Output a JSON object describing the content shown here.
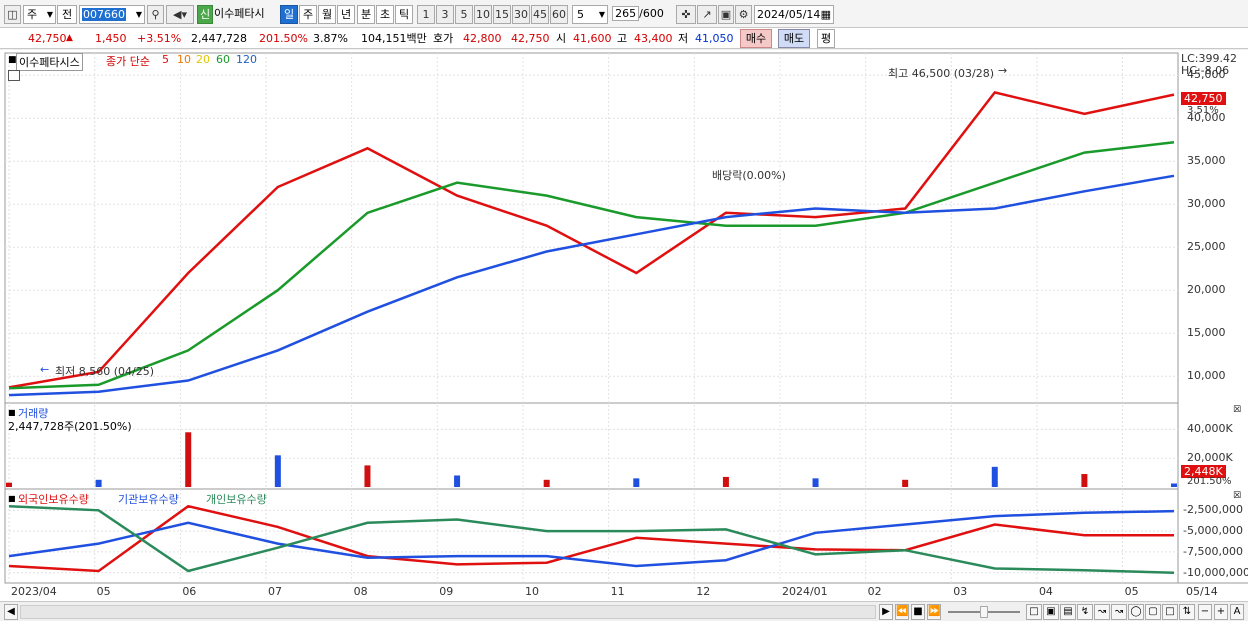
{
  "toolbar": {
    "market_select": "주",
    "compare_select": "전",
    "code": "007660",
    "stock_flag": "신",
    "stock_name": "이수페타시",
    "periods": [
      "일",
      "주",
      "월",
      "년",
      "분",
      "초",
      "틱"
    ],
    "active_period": "일",
    "intervals": [
      "1",
      "3",
      "5",
      "10",
      "15",
      "30",
      "45",
      "60"
    ],
    "interval_value": "5",
    "count": "265",
    "count_total": "/600",
    "date": "2024/05/14"
  },
  "info": {
    "price": "42,750",
    "change": "1,450",
    "change_pct": "+3.51%",
    "volume": "2,447,728",
    "vol_ratio": "201.50%",
    "turnover": "3.87%",
    "amount": "104,151백만",
    "ask_label": "호가",
    "ask": "42,800",
    "bid": "42,750",
    "open_label": "시",
    "open": "41,600",
    "high_label": "고",
    "high": "43,400",
    "low_label": "저",
    "low": "41,050",
    "buy_button": "매수",
    "sell_button": "매도",
    "eval_button": "평"
  },
  "price_panel": {
    "stock_label": "이수페타시스",
    "ma_label": "종가 단순",
    "ma_periods": [
      "5",
      "10",
      "20",
      "60",
      "120"
    ],
    "ma_colors": [
      "#e01010",
      "#f07800",
      "#f0e000",
      "#1a9a2a",
      "#2050e0"
    ],
    "lc": "LC:399.42",
    "hc": "HC:-8.06",
    "current_price": "42,750",
    "current_pct": "3.51%",
    "max_annotation": "최고 46,500 (03/28)",
    "min_annotation": "최저 8,560 (04/25)",
    "dividend_annotation": "배당락(0.00%)",
    "y_ticks": [
      "45,000",
      "40,000",
      "35,000",
      "30,000",
      "25,000",
      "20,000",
      "15,000",
      "10,000"
    ]
  },
  "volume_panel": {
    "title": "거래량",
    "value": "2,447,728주(201.50%)",
    "y_ticks": [
      "40,000K",
      "20,000K"
    ],
    "current": "2,448K",
    "current_pct": "201.50%"
  },
  "holding_panel": {
    "series": [
      "외국인보유수량",
      "기관보유수량",
      "개인보유수량"
    ],
    "colors": [
      "#e01010",
      "#2050e0",
      "#2a8a5a"
    ],
    "y_ticks": [
      "-2,500,000",
      "-5,000,000",
      "-7,500,000",
      "-10,000,000"
    ]
  },
  "x_axis": {
    "labels": [
      "2023/04",
      "05",
      "06",
      "07",
      "08",
      "09",
      "10",
      "11",
      "12",
      "2024/01",
      "02",
      "03",
      "04",
      "05"
    ],
    "end_label": "05/14"
  },
  "chart_data": [
    {
      "type": "line",
      "title": "이수페타시스",
      "x": [
        "2023/04",
        "2023/05",
        "2023/06",
        "2023/07",
        "2023/08",
        "2023/09",
        "2023/10",
        "2023/11",
        "2023/12",
        "2024/01",
        "2024/02",
        "2024/03",
        "2024/04",
        "2024/05/14"
      ],
      "series": [
        {
          "name": "5",
          "values": [
            8700,
            10500,
            22000,
            32000,
            36500,
            31000,
            27500,
            22000,
            29000,
            28500,
            29500,
            43000,
            40500,
            42750
          ]
        },
        {
          "name": "60",
          "values": [
            8600,
            9000,
            13000,
            20000,
            29000,
            32500,
            31000,
            28500,
            27500,
            27500,
            29000,
            32500,
            36000,
            37200
          ]
        },
        {
          "name": "120",
          "values": [
            7800,
            8200,
            9500,
            13000,
            17500,
            21500,
            24500,
            26500,
            28500,
            29500,
            29000,
            29500,
            31500,
            33300
          ]
        }
      ],
      "ylim": [
        7000,
        47000
      ],
      "annotations": [
        "최고 46,500 (03/28)",
        "최저 8,560 (04/25)",
        "배당락(0.00%)"
      ]
    },
    {
      "type": "bar",
      "title": "거래량",
      "x": [
        "2023/04",
        "2023/05",
        "2023/06",
        "2023/07",
        "2023/08",
        "2023/09",
        "2023/10",
        "2023/11",
        "2023/12",
        "2024/01",
        "2024/02",
        "2024/03",
        "2024/04",
        "2024/05/14"
      ],
      "values": [
        3000,
        5000,
        38000,
        22000,
        15000,
        8000,
        5000,
        6000,
        7000,
        6000,
        5000,
        14000,
        9000,
        2448
      ],
      "ylim": [
        0,
        50000
      ]
    },
    {
      "type": "line",
      "x": [
        "2023/04",
        "2023/05",
        "2023/06",
        "2023/07",
        "2023/08",
        "2023/09",
        "2023/10",
        "2023/11",
        "2023/12",
        "2024/01",
        "2024/02",
        "2024/03",
        "2024/04",
        "2024/05/14"
      ],
      "series": [
        {
          "name": "외국인보유수량",
          "values": [
            -9200000,
            -9800000,
            -2000000,
            -4500000,
            -8000000,
            -9000000,
            -8800000,
            -5800000,
            -6500000,
            -7200000,
            -7300000,
            -4200000,
            -5500000,
            -5500000
          ]
        },
        {
          "name": "기관보유수량",
          "values": [
            -8000000,
            -6500000,
            -4000000,
            -6500000,
            -8200000,
            -8000000,
            -8000000,
            -9200000,
            -8500000,
            -5200000,
            -4200000,
            -3200000,
            -2800000,
            -2600000
          ]
        },
        {
          "name": "개인보유수량",
          "values": [
            -2000000,
            -2500000,
            -9800000,
            -7000000,
            -4000000,
            -3600000,
            -5000000,
            -5000000,
            -4800000,
            -7800000,
            -7300000,
            -9500000,
            -9700000,
            -10000000
          ]
        }
      ],
      "ylim": [
        -11000000,
        -1500000
      ]
    }
  ]
}
